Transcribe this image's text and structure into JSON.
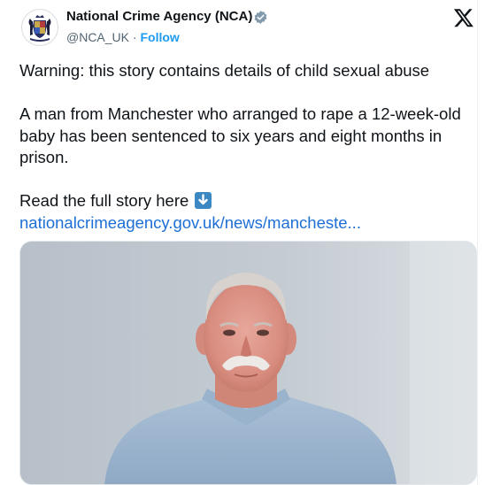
{
  "author": {
    "name": "National Crime Agency (NCA)",
    "handle": "@NCA_UK",
    "separator": "·",
    "follow_label": "Follow"
  },
  "tweet": {
    "line_warning": "Warning: this story contains details of child sexual abuse",
    "line_body": "A man from Manchester who arranged to rape a 12-week-old baby has been sentenced to six years and eight months in prison.",
    "line_read": "Read the full story here",
    "link_text": "nationalcrimeagency.gov.uk/news/mancheste..."
  },
  "icons": {
    "avatar": "nca-crest-icon",
    "verified": "verified-badge-icon",
    "platform": "x-logo-icon",
    "emoji": "down-arrow-emoji-icon"
  },
  "colors": {
    "accent": "#1d9bf0",
    "text": "#0f1419",
    "muted": "#536471",
    "emoji_bg": "#3b88c3"
  }
}
